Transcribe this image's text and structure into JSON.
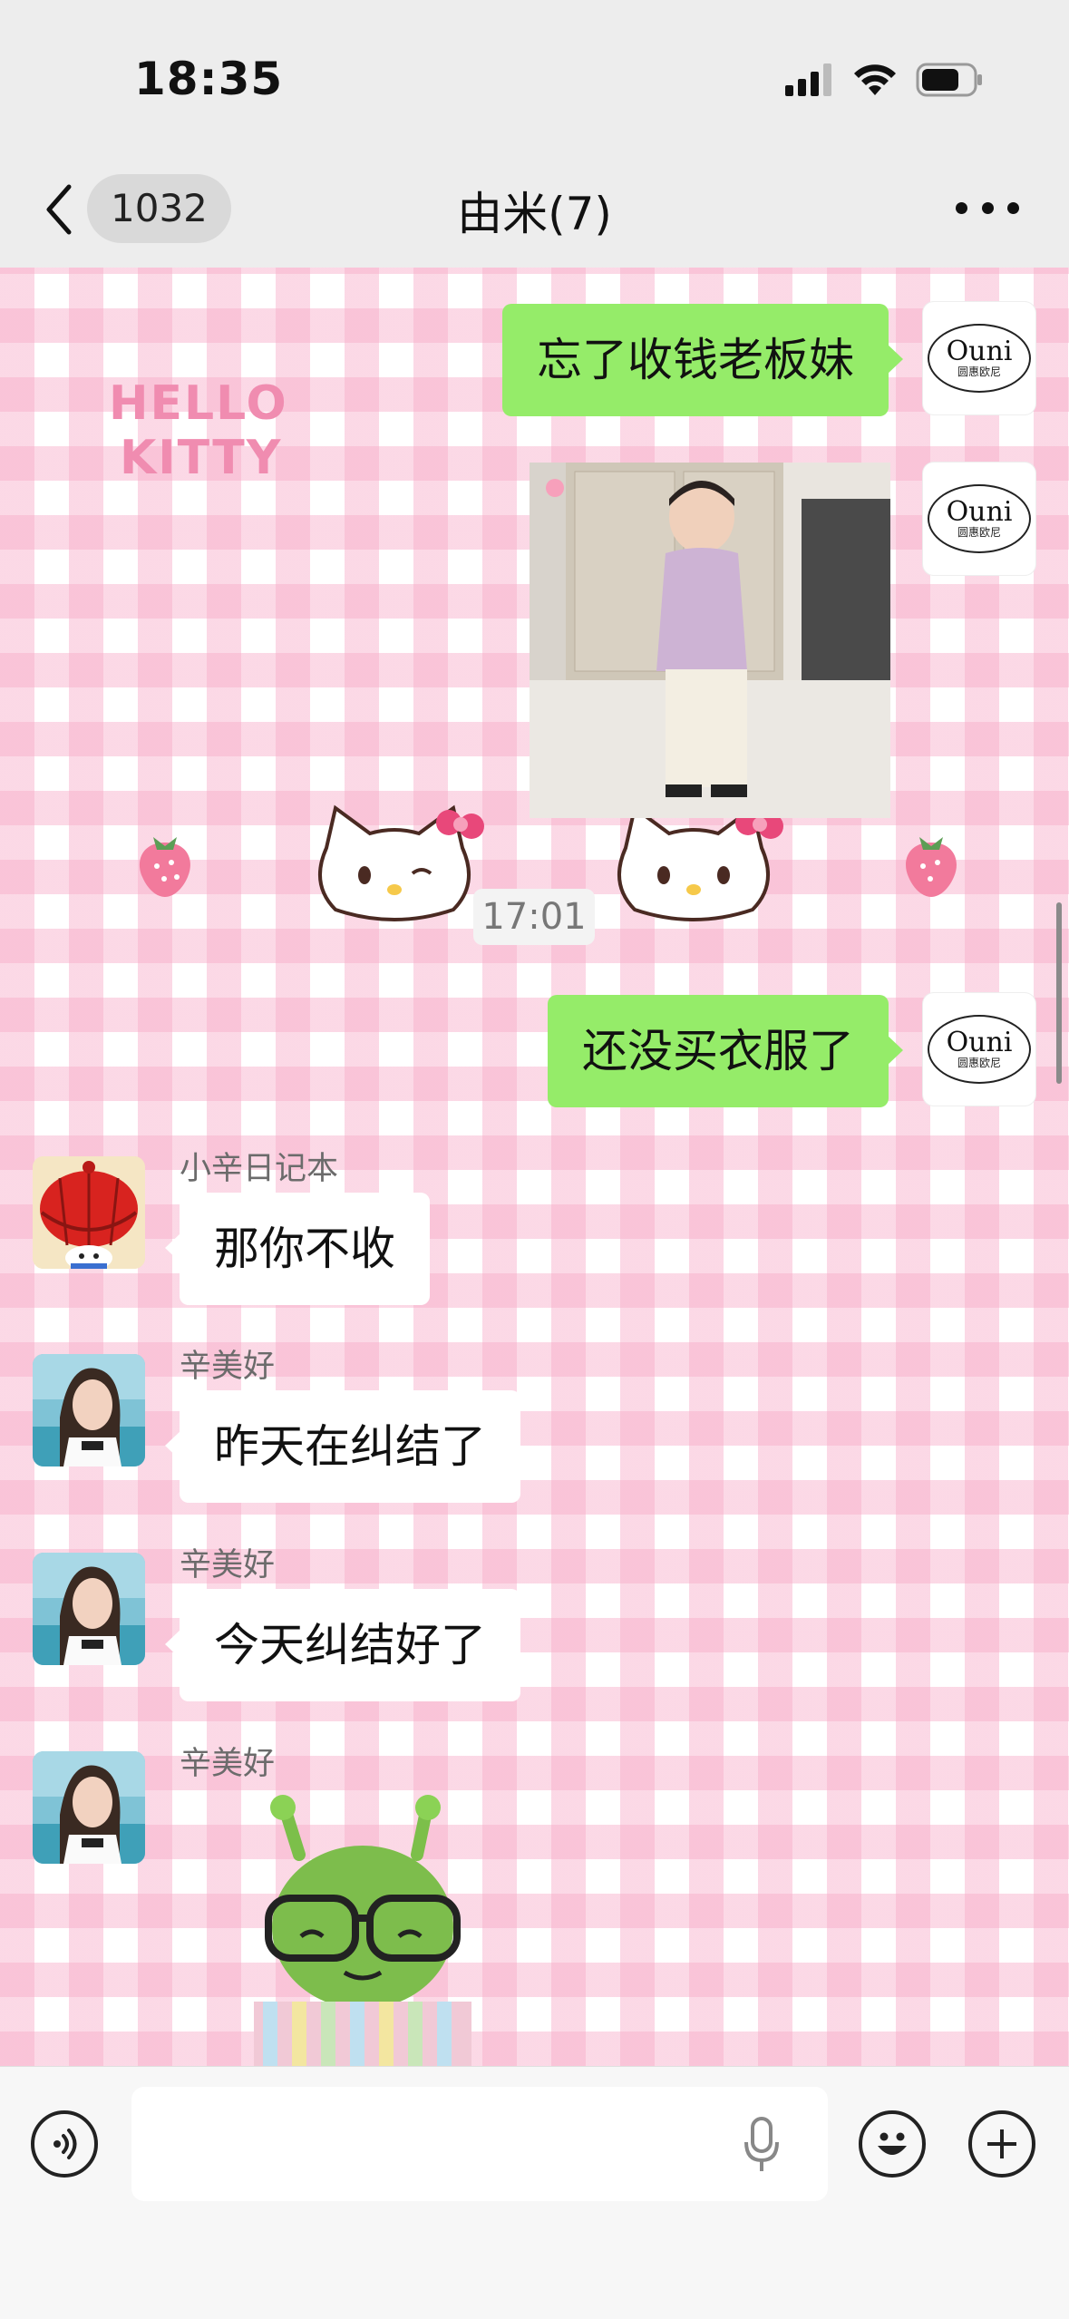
{
  "status_bar": {
    "time": "18:35",
    "icons": [
      "signal-icon",
      "wifi-icon",
      "battery-icon"
    ]
  },
  "header": {
    "back_count": "1032",
    "title": "由米(7)"
  },
  "messages": {
    "m1": {
      "text": "忘了收钱老板妹",
      "avatar": "Ouni",
      "avatar_sub": "圆惠欧尼"
    },
    "m2": {
      "type": "image",
      "avatar": "Ouni",
      "avatar_sub": "圆惠欧尼"
    },
    "timestamp": "17:01",
    "m3": {
      "text": "还没买衣服了",
      "avatar": "Ouni",
      "avatar_sub": "圆惠欧尼"
    },
    "m4": {
      "sender": "小辛日记本",
      "text": "那你不收"
    },
    "m5": {
      "sender": "辛美好",
      "text": "昨天在纠结了"
    },
    "m6": {
      "sender": "辛美好",
      "text": "今天纠结好了"
    },
    "m7": {
      "sender": "辛美好",
      "type": "sticker"
    }
  },
  "background": {
    "label_line1": "HELLO",
    "label_line2": "KITTY"
  },
  "input": {
    "value": "",
    "placeholder": ""
  },
  "colors": {
    "bubble_self": "#95ec69",
    "bubble_other": "#ffffff",
    "gingham": "#f7aac8"
  }
}
